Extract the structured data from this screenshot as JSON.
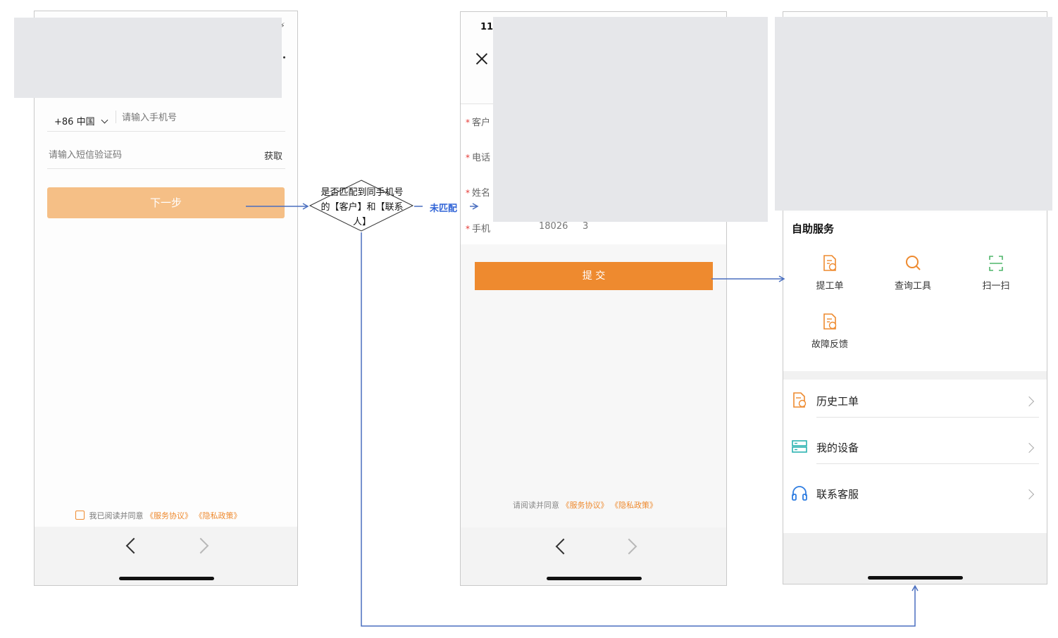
{
  "phone1": {
    "country_code": "+86 中国",
    "phone_placeholder": "请输入手机号",
    "sms_placeholder": "请输入短信验证码",
    "get_code": "获取",
    "next_button": "下一步",
    "agree_text": "我已阅读并同意",
    "service_link": "《服务协议》",
    "privacy_link": "《隐私政策》"
  },
  "decision": {
    "line1": "是否匹配到同手机号",
    "line2": "的【客户】和【联系",
    "line3": "人】",
    "unmatched_label": "未匹配"
  },
  "phone2": {
    "time": "11:",
    "fields": [
      {
        "label": "客户"
      },
      {
        "label": "电话"
      },
      {
        "label": "姓名"
      },
      {
        "label": "手机",
        "value": "18026     3"
      }
    ],
    "submit": "提 交",
    "agree_text": "请阅读并同意",
    "service_link": "《服务协议》",
    "privacy_link": "《隐私政策》"
  },
  "phone3": {
    "section_title": "自助服务",
    "grid": [
      {
        "label": "提工单",
        "icon": "ticket-icon"
      },
      {
        "label": "查询工具",
        "icon": "search-icon"
      },
      {
        "label": "扫一扫",
        "icon": "scan-icon"
      },
      {
        "label": "故障反馈",
        "icon": "feedback-icon"
      }
    ],
    "menu": [
      {
        "label": "历史工单",
        "icon": "history-ticket-icon"
      },
      {
        "label": "我的设备",
        "icon": "device-icon"
      },
      {
        "label": "联系客服",
        "icon": "headset-icon"
      }
    ]
  },
  "colors": {
    "accent_orange": "#ee8a2f",
    "disabled_orange": "#f5bf86",
    "connector_blue": "#4a6fbf",
    "unmatched_text": "#2f63d6"
  }
}
